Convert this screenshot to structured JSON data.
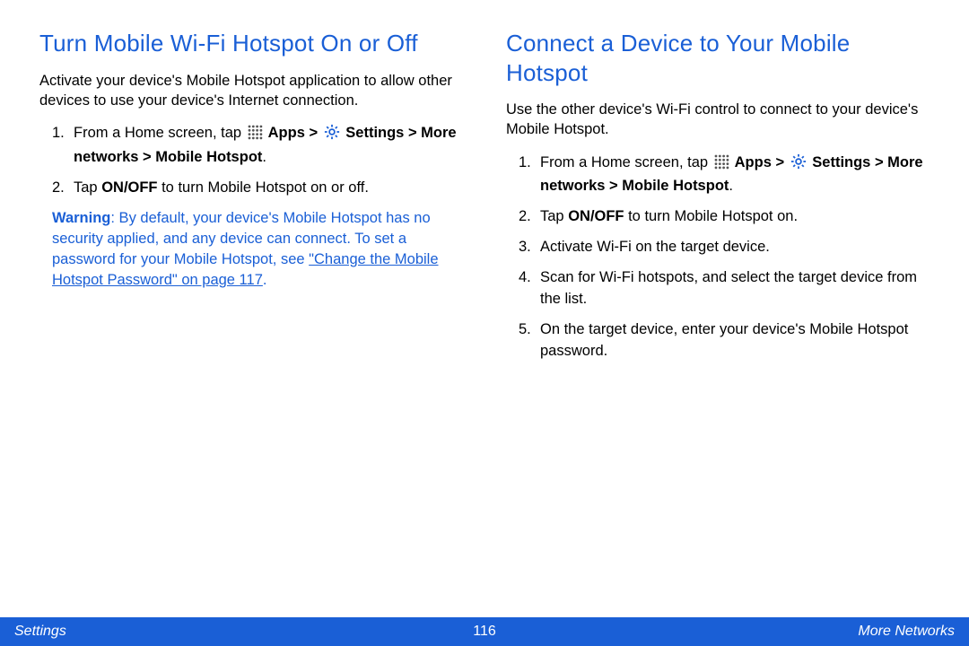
{
  "left": {
    "heading": "Turn Mobile Wi-Fi Hotspot On or Off",
    "intro": "Activate your device's Mobile Hotspot application to allow other devices to use your device's Internet connection.",
    "step1_pre": "From a Home screen, tap ",
    "apps": " Apps > ",
    "settings": " Settings > More networks > Mobile Hotspot",
    "step2_a": "Tap ",
    "step2_b": "ON/OFF",
    "step2_c": " to turn Mobile Hotspot on or off.",
    "warn_label": "Warning",
    "warn_text": ": By default, your device's Mobile Hotspot has no security applied, and any device can connect. To set a password for your Mobile Hotspot, see ",
    "warn_link": "\"Change the Mobile Hotspot Password\" on page 117",
    "period": "."
  },
  "right": {
    "heading": "Connect a Device to Your Mobile Hotspot",
    "intro": "Use the other device's Wi-Fi control to connect to your device's Mobile Hotspot.",
    "step1_pre": "From a Home screen, tap ",
    "apps": " Apps > ",
    "settings": " Settings > More networks > Mobile Hotspot",
    "step2_a": "Tap ",
    "step2_b": "ON/OFF",
    "step2_c": " to turn Mobile Hotspot on.",
    "step3": "Activate Wi-Fi on the target device.",
    "step4": "Scan for Wi-Fi hotspots, and select the target device from the list.",
    "step5": "On the target device, enter your device's Mobile Hotspot password."
  },
  "footer": {
    "left": "Settings",
    "center": "116",
    "right": "More Networks"
  },
  "nums": {
    "n1": "1.",
    "n2": "2.",
    "n3": "3.",
    "n4": "4.",
    "n5": "5."
  }
}
